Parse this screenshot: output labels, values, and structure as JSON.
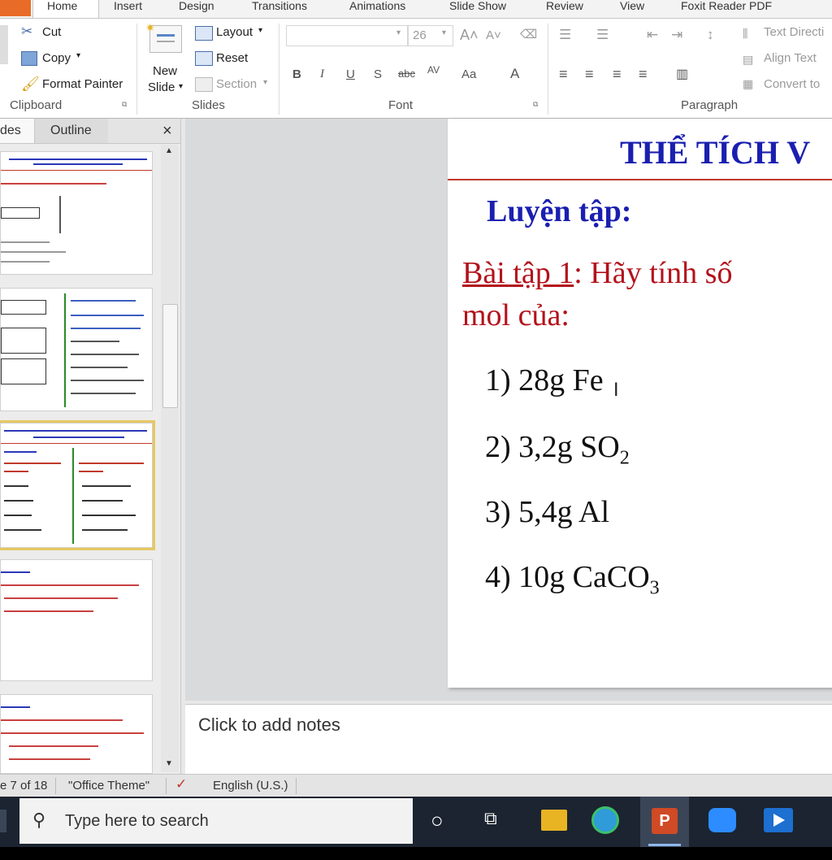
{
  "ribbon_tabs": [
    "Home",
    "Insert",
    "Design",
    "Transitions",
    "Animations",
    "Slide Show",
    "Review",
    "View",
    "Foxit Reader PDF"
  ],
  "clipboard": {
    "cut": "Cut",
    "copy": "Copy",
    "format_painter": "Format Painter",
    "group": "Clipboard"
  },
  "slides_group": {
    "new_slide_1": "New",
    "new_slide_2": "Slide",
    "layout": "Layout",
    "reset": "Reset",
    "section": "Section",
    "group": "Slides"
  },
  "font": {
    "size": "26",
    "group": "Font"
  },
  "paragraph": {
    "text_direction": "Text Directi",
    "align_text": "Align Text",
    "convert": "Convert to",
    "group": "Paragraph"
  },
  "left_pane": {
    "tab_slides": "des",
    "tab_outline": "Outline",
    "close": "×"
  },
  "slide": {
    "title_partial": "THỂ TÍCH V",
    "heading": "Luyện tập:",
    "exercise_label": "Bài tập 1",
    "exercise_rest": ": Hãy tính số",
    "exercise_line2": "mol của:",
    "items": [
      {
        "num": "1)",
        "text": "28g Fe",
        "sub": ""
      },
      {
        "num": "2)",
        "text": "3,2g SO",
        "sub": "2"
      },
      {
        "num": "3)",
        "text": "5,4g Al",
        "sub": ""
      },
      {
        "num": "4)",
        "text": "10g CaCO",
        "sub": "3"
      }
    ]
  },
  "notes_placeholder": "Click to add notes",
  "status": {
    "slide_pos": "e 7 of 18",
    "theme": "\"Office Theme\"",
    "language": "English (U.S.)"
  },
  "taskbar": {
    "search_placeholder": "Type here to search"
  },
  "colors": {
    "accent_orange": "#e86c27",
    "slide_blue": "#1a1fb0",
    "slide_red": "#b3121b",
    "title_rule": "#c0392b"
  }
}
